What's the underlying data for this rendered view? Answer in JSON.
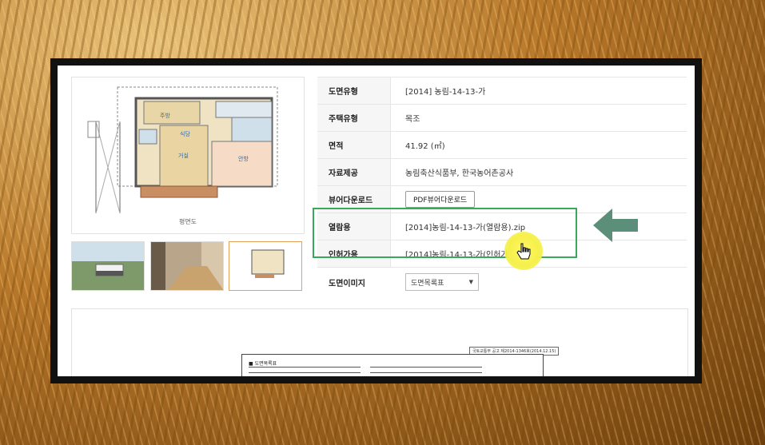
{
  "plan": {
    "caption": "평면도"
  },
  "thumbnails": [
    {
      "name": "exterior-photo"
    },
    {
      "name": "interior-photo"
    },
    {
      "name": "floorplan-thumb",
      "selected": true
    }
  ],
  "info_rows": [
    {
      "label": "도면유형",
      "value": "[2014] 농림-14-13-가"
    },
    {
      "label": "주택유형",
      "value": "목조"
    },
    {
      "label": "면적",
      "value": "41.92 (㎡)"
    },
    {
      "label": "자료제공",
      "value": "농림축산식품부, 한국농어촌공사"
    },
    {
      "label": "뷰어다운로드",
      "button": "PDF뷰어다운로드"
    },
    {
      "label": "열람용",
      "link": "[2014]농림-14-13-가(열람용).zip"
    },
    {
      "label": "인허가용",
      "link": "[2014]농림-14-13-가(인허가용).zip"
    },
    {
      "label": "도면이미지",
      "select": "도면목록표"
    }
  ],
  "doc": {
    "title": "■ 도면목록표",
    "header": "국토교통부 공고 제2014-1346호(2014.12.15)"
  },
  "colors": {
    "highlight": "#3aa85a",
    "arrow": "#5b8f7a",
    "cursor_glow": "#f6f04a"
  }
}
